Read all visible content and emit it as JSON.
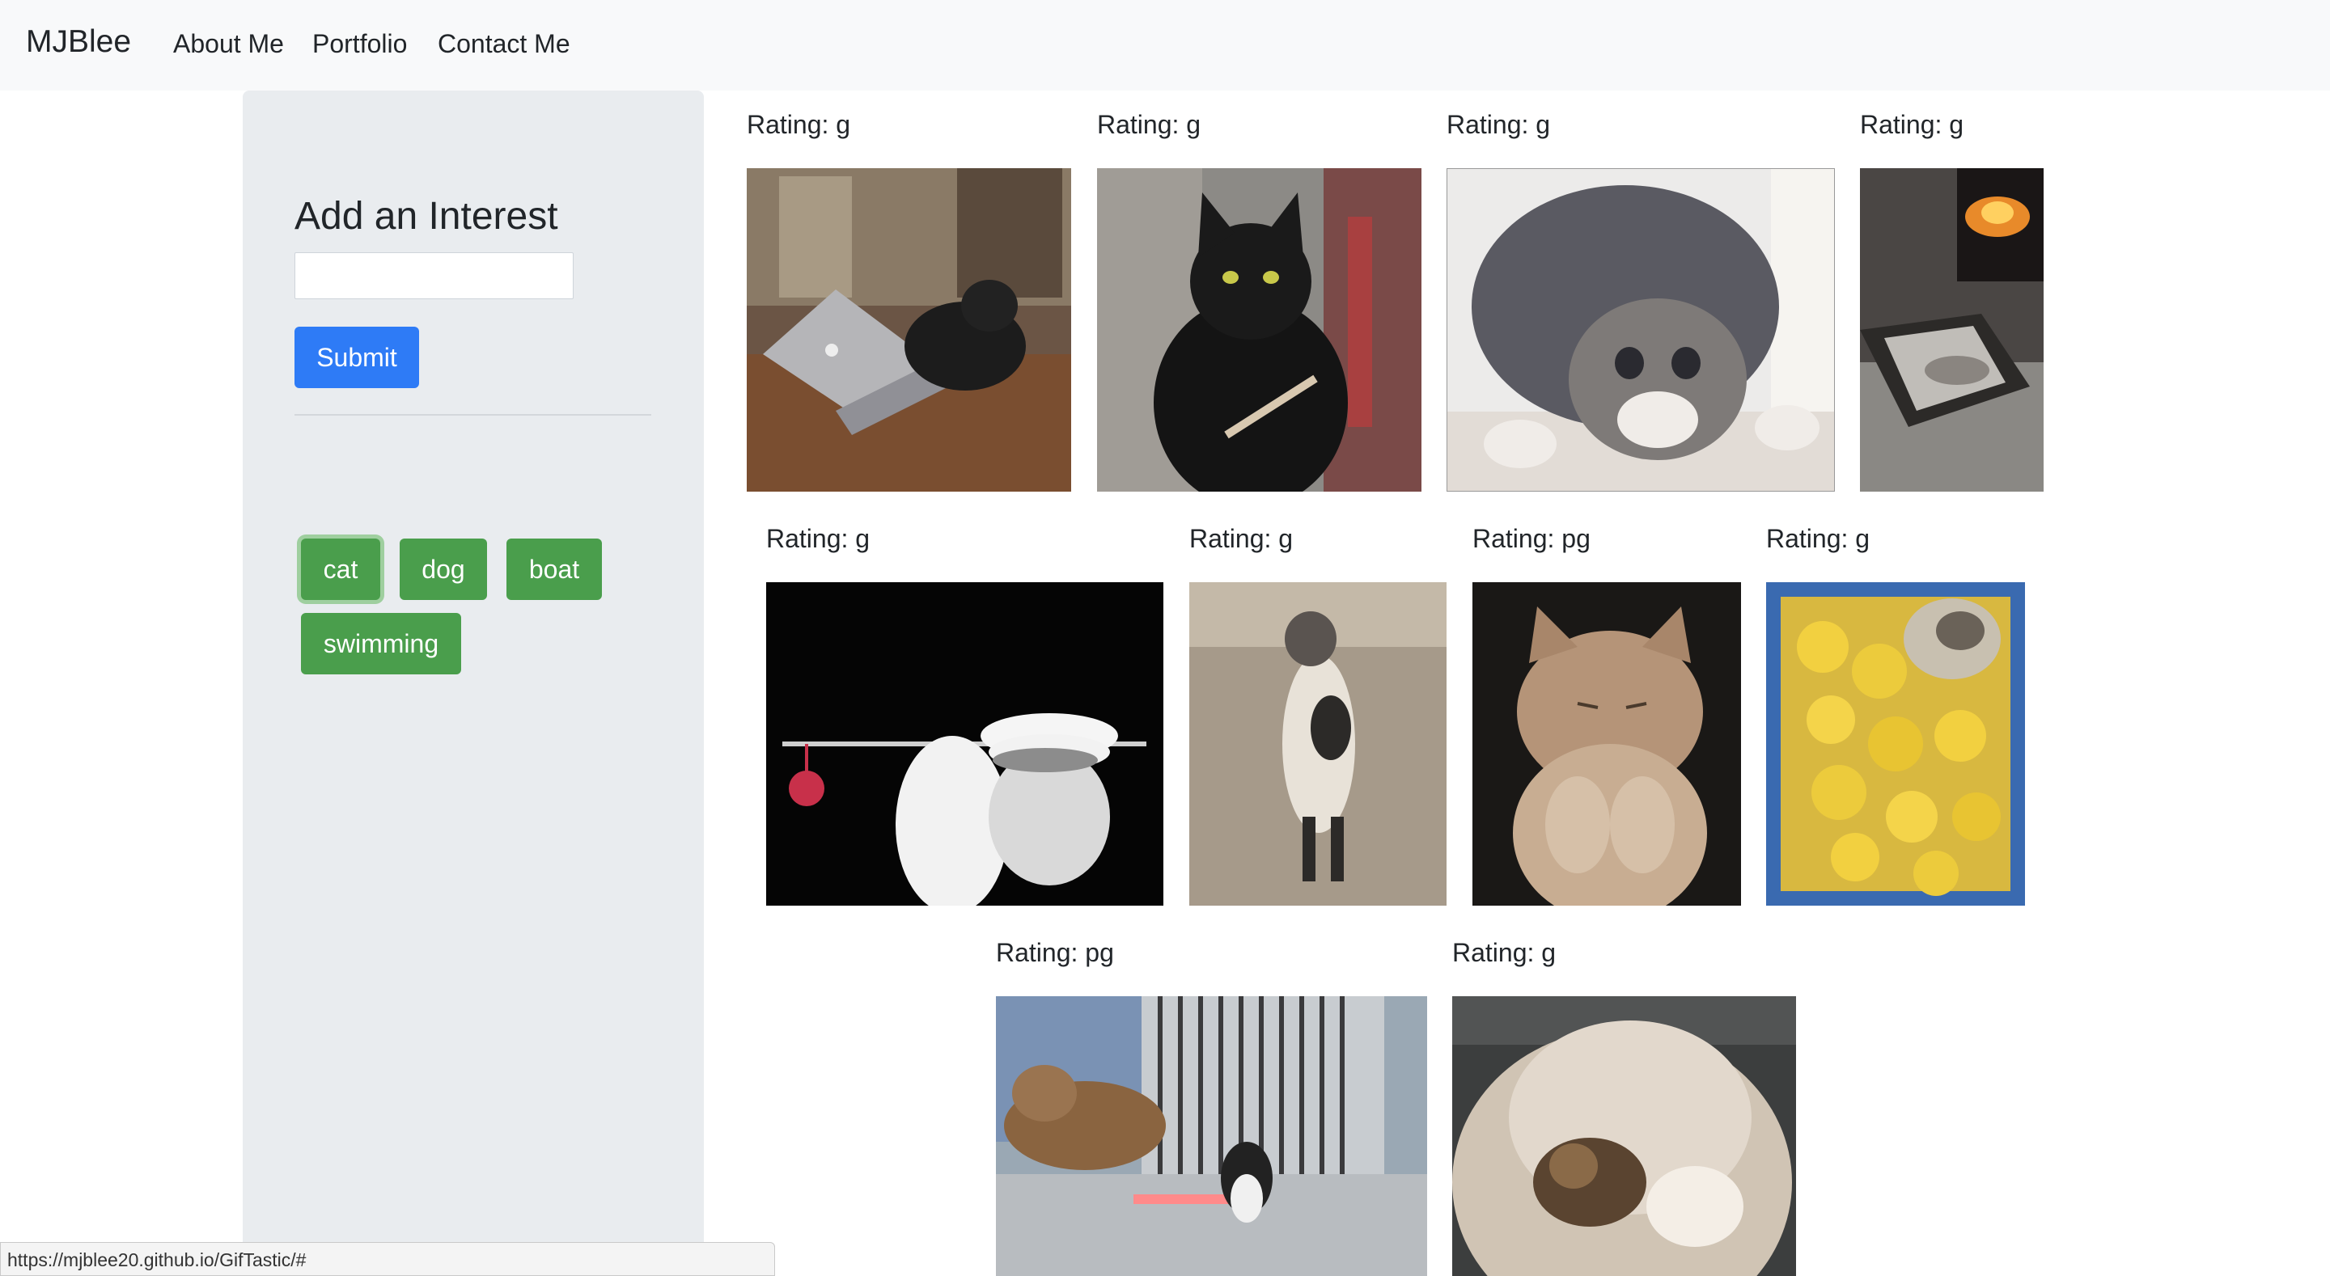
{
  "navbar": {
    "brand": "MJBlee",
    "links": [
      "About Me",
      "Portfolio",
      "Contact Me"
    ]
  },
  "sidebar": {
    "title": "Add an Interest",
    "input_value": "",
    "submit_label": "Submit",
    "topics": [
      "cat",
      "dog",
      "boat",
      "swimming"
    ],
    "active_topic": "cat"
  },
  "gifs": [
    {
      "rating": "Rating: g"
    },
    {
      "rating": "Rating: g"
    },
    {
      "rating": "Rating: g"
    },
    {
      "rating": "Rating: g"
    },
    {
      "rating": "Rating: g"
    },
    {
      "rating": "Rating: g"
    },
    {
      "rating": "Rating: pg"
    },
    {
      "rating": "Rating: g"
    },
    {
      "rating": "Rating: pg"
    },
    {
      "rating": "Rating: g"
    }
  ],
  "status_bar": {
    "url": "https://mjblee20.github.io/GifTastic/#"
  }
}
